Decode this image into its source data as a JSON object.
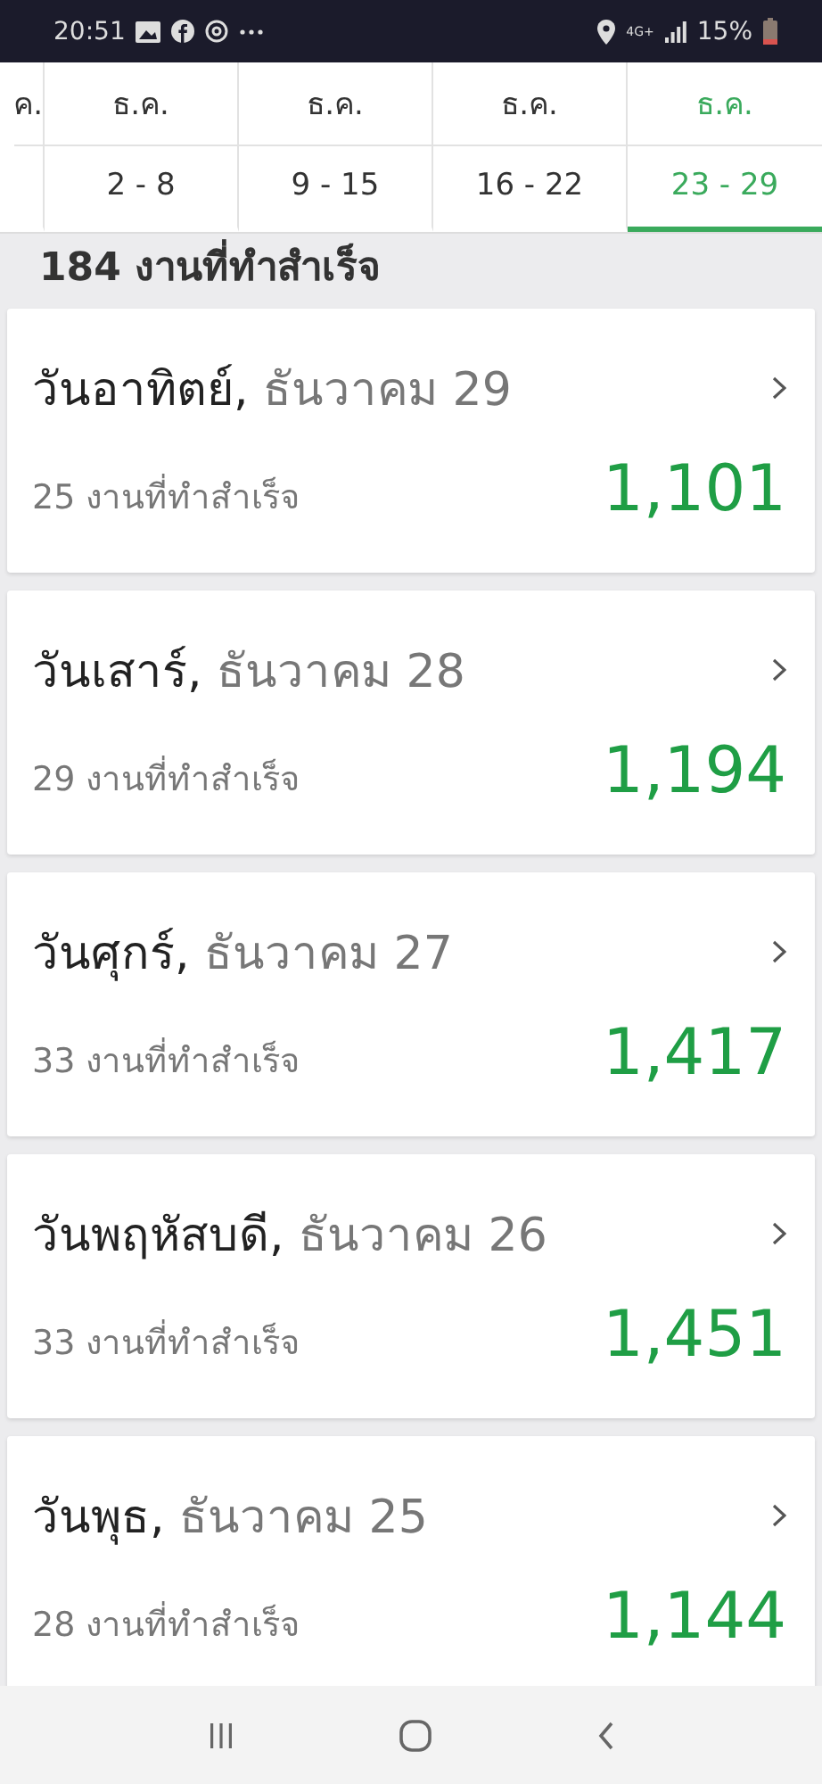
{
  "status_bar": {
    "time": "20:51",
    "network": "4G+",
    "battery": "15%"
  },
  "week_tabs": [
    {
      "month": "ค.",
      "selected": false
    },
    {
      "month": "ธ.ค.",
      "range": "2 - 8",
      "selected": false
    },
    {
      "month": "ธ.ค.",
      "range": "9 - 15",
      "selected": false
    },
    {
      "month": "ธ.ค.",
      "range": "16 - 22",
      "selected": false
    },
    {
      "month": "ธ.ค.",
      "range": "23 - 29",
      "selected": true
    }
  ],
  "summary": "184 งานที่ทำสำเร็จ",
  "days": [
    {
      "weekday": "วันอาทิตย์,",
      "date": "ธันวาคม 29",
      "jobs": "25 งานที่ทำสำเร็จ",
      "amount": "1,101"
    },
    {
      "weekday": "วันเสาร์,",
      "date": "ธันวาคม 28",
      "jobs": "29 งานที่ทำสำเร็จ",
      "amount": "1,194"
    },
    {
      "weekday": "วันศุกร์,",
      "date": "ธันวาคม 27",
      "jobs": "33 งานที่ทำสำเร็จ",
      "amount": "1,417"
    },
    {
      "weekday": "วันพฤหัสบดี,",
      "date": "ธันวาคม 26",
      "jobs": "33 งานที่ทำสำเร็จ",
      "amount": "1,451"
    },
    {
      "weekday": "วันพุธ,",
      "date": "ธันวาคม 25",
      "jobs": "28 งานที่ทำสำเร็จ",
      "amount": "1,144"
    }
  ]
}
